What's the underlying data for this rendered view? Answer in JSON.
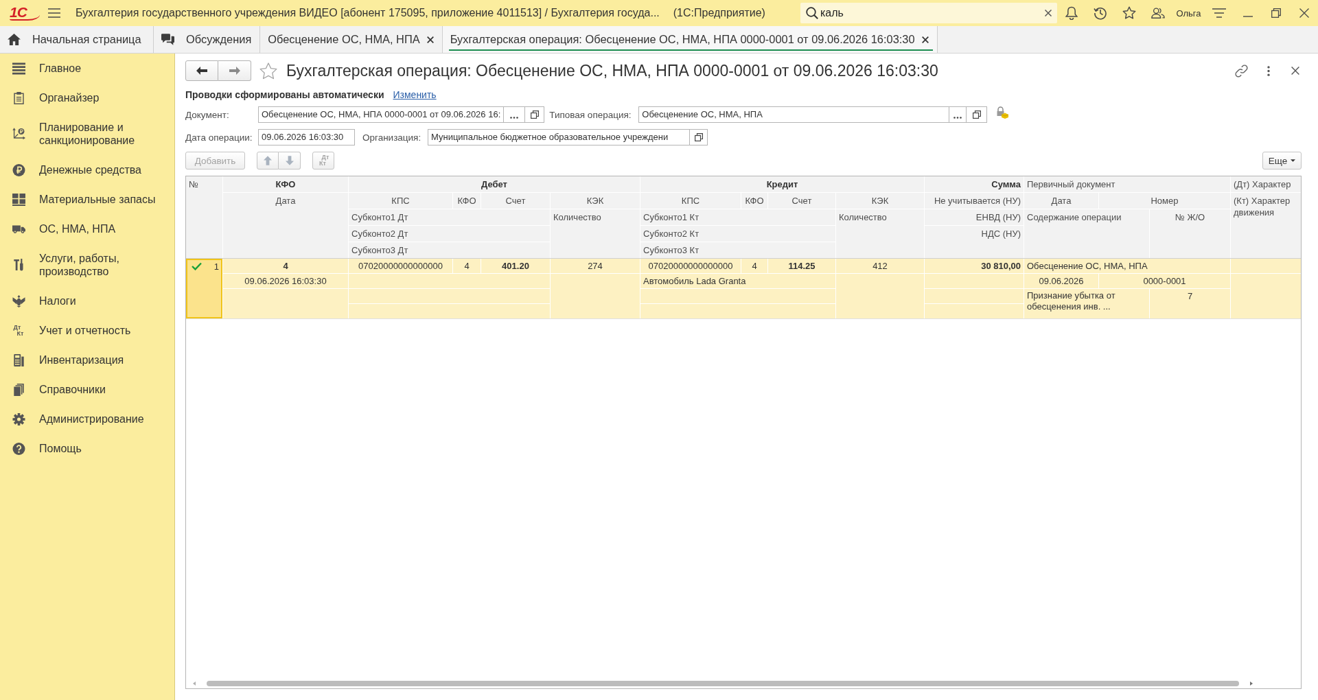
{
  "titlebar": {
    "logo": "1С",
    "title": "Бухгалтерия государственного учреждения ВИДЕО [абонент 175095, приложение 4011513] / Бухгалтерия госуда...",
    "platform": "(1С:Предприятие)",
    "search": {
      "value": "каль"
    },
    "user": "Ольга"
  },
  "tabs": [
    {
      "label": "Начальная страница",
      "kind": "home",
      "selected": false
    },
    {
      "label": "Обсуждения",
      "kind": "discussions",
      "selected": false
    },
    {
      "label": "Обесценение ОС, НМА, НПА",
      "kind": "form",
      "selected": false
    },
    {
      "label": "Бухгалтерская операция: Обесценение ОС, НМА, НПА 0000-0001 от 09.06.2026 16:03:30",
      "kind": "form",
      "selected": true
    }
  ],
  "sidebar": {
    "items": [
      {
        "label": "Главное",
        "selected": false
      },
      {
        "label": "Органайзер",
        "selected": false
      },
      {
        "label": "Планирование и санкционирование",
        "selected": false
      },
      {
        "label": "Денежные средства",
        "selected": false
      },
      {
        "label": "Материальные запасы",
        "selected": false
      },
      {
        "label": "ОС, НМА, НПА",
        "selected": false
      },
      {
        "label": "Услуги, работы, производство",
        "selected": false
      },
      {
        "label": "Налоги",
        "selected": false
      },
      {
        "label": "Учет и отчетность",
        "icon_letters": [
          "Дт",
          "Кт"
        ],
        "selected": false
      },
      {
        "label": "Инвентаризация",
        "selected": false
      },
      {
        "label": "Справочники",
        "selected": false
      },
      {
        "label": "Администрирование",
        "selected": false
      },
      {
        "label": "Помощь",
        "selected": false
      }
    ]
  },
  "form": {
    "title": "Бухгалтерская операция: Обесценение ОС, НМА, НПА 0000-0001 от 09.06.2026 16:03:30",
    "favorite": false,
    "notice": "Проводки сформированы автоматически",
    "notice_link": "Изменить",
    "fields": {
      "document": {
        "label": "Документ:",
        "value": "Обесценение ОС, НМА, НПА 0000-0001 от 09.06.2026 16:"
      },
      "operation_type": {
        "label": "Типовая операция:",
        "value": "Обесценение ОС, НМА, НПА"
      },
      "date": {
        "label": "Дата операции:",
        "value": "09.06.2026 16:03:30"
      },
      "organization": {
        "label": "Организация:",
        "value": "Муниципальное бюджетное образовательное учреждени"
      }
    },
    "toolbar": {
      "add": {
        "label": "Добавить",
        "disabled": true
      },
      "move": {
        "disabled": true
      },
      "swap": {
        "letters": [
          "Дт",
          "Кт"
        ],
        "disabled": true
      },
      "more": "Еще"
    }
  },
  "table": {
    "header": {
      "number": "№",
      "kfo": {
        "title": "КФО",
        "date": "Дата"
      },
      "debit": {
        "title": "Дебет",
        "kps": "КПС",
        "kfo": "КФО",
        "account": "Счет",
        "kek": "КЭК",
        "subkonto": [
          "Субконто1 Дт",
          "Субконто2 Дт",
          "Субконто3 Дт"
        ],
        "quantity": "Количество"
      },
      "credit": {
        "title": "Кредит",
        "kps": "КПС",
        "kfo": "КФО",
        "account": "Счет",
        "kek": "КЭК",
        "subkonto": [
          "Субконто1 Кт",
          "Субконто2 Кт",
          "Субконто3 Кт"
        ],
        "quantity": "Количество"
      },
      "sum": {
        "title": "Сумма",
        "lines": [
          "Не учитывается (НУ)",
          "ЕНВД (НУ)",
          "НДС (НУ)"
        ]
      },
      "primary_document": {
        "title": "Первичный документ",
        "date": "Дата",
        "number": "Номер",
        "content": "Содержание операции",
        "journal": "№ Ж/О"
      },
      "movement": [
        "(Дт) Характер",
        "(Кт) Характер движения"
      ]
    },
    "rows": [
      {
        "selected": true,
        "active": true,
        "number": "1",
        "kfo": "4",
        "date": "09.06.2026 16:03:30",
        "debit": {
          "kps": "07020000000000000",
          "kfo": "4",
          "account": "401.20",
          "kek": "274"
        },
        "credit": {
          "kps": "07020000000000000",
          "kfo": "4",
          "account": "114.25",
          "kek": "412",
          "subkonto": [
            "Автомобиль Lada Granta"
          ]
        },
        "sum": "30 810,00",
        "primary_document": {
          "name": "Обесценение ОС, НМА, НПА",
          "date": "09.06.2026",
          "number": "0000-0001",
          "content": "Признание убытка от обесценения инв. ...",
          "journal": "7"
        }
      }
    ]
  }
}
